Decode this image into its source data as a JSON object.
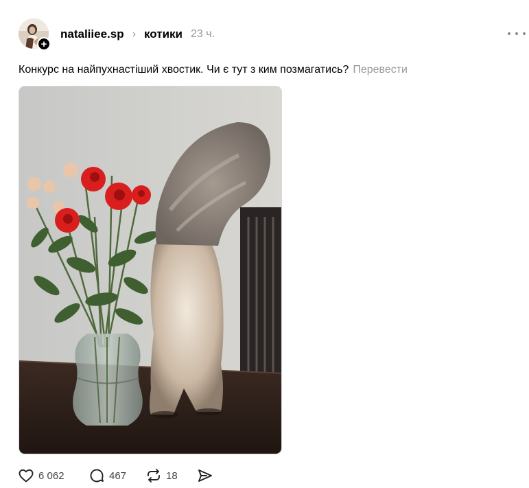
{
  "post": {
    "author": "nataliiee.sp",
    "community": "котики",
    "time": "23 ч.",
    "caption": "Конкурс на найпухнастіший хвостик. Чи є тут з ким позмагатись?",
    "translate_label": "Перевести"
  },
  "header": {
    "follow_symbol": "+",
    "separator": "›"
  },
  "actions": {
    "likes": "6 062",
    "replies": "467",
    "reposts": "18"
  },
  "icons": {
    "avatar": "avatar",
    "follow": "plus-icon",
    "more": "more-icon",
    "like": "heart-icon",
    "reply": "comment-icon",
    "repost": "repost-icon",
    "share": "send-icon"
  },
  "colors": {
    "text": "#000000",
    "muted": "#999999",
    "rose": "#d91e1e"
  }
}
